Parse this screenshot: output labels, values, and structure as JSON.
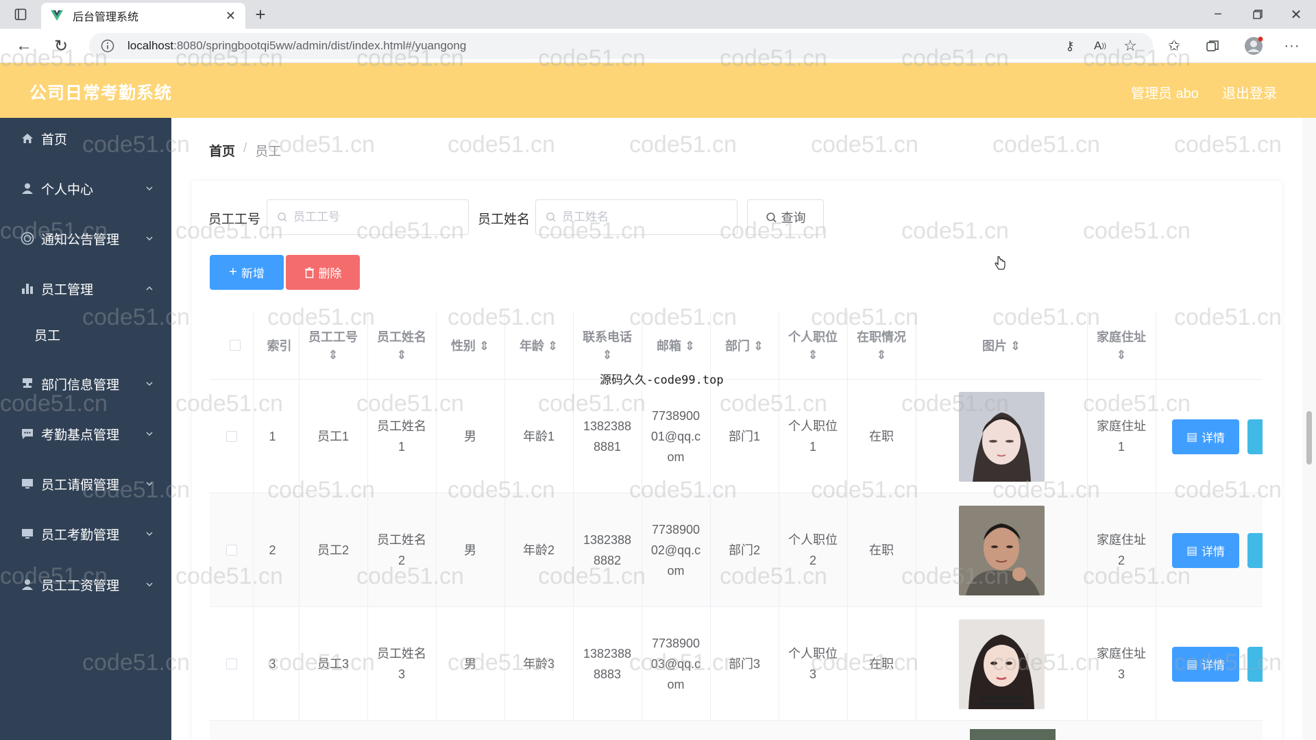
{
  "browser": {
    "tab_title": "后台管理系统",
    "url_host": "localhost",
    "url_rest": ":8080/springbootqi5ww/admin/dist/index.html#/yuangong"
  },
  "header": {
    "title": "公司日常考勤系统",
    "admin_label": "管理员 abo",
    "logout_label": "退出登录",
    "bg_color": "#fdd576"
  },
  "sidebar": {
    "bg_color": "#304156",
    "items": [
      {
        "label": "首页",
        "icon": "home-icon"
      },
      {
        "label": "个人中心",
        "icon": "user-icon"
      },
      {
        "label": "通知公告管理",
        "icon": "circle-icon"
      },
      {
        "label": "员工管理",
        "icon": "bar-chart-icon",
        "expanded": true,
        "sub": "员工"
      },
      {
        "label": "部门信息管理",
        "icon": "stamp-icon"
      },
      {
        "label": "考勤基点管理",
        "icon": "chat-icon"
      },
      {
        "label": "员工请假管理",
        "icon": "monitor-icon"
      },
      {
        "label": "员工考勤管理",
        "icon": "monitor-icon"
      },
      {
        "label": "员工工资管理",
        "icon": "user-icon"
      }
    ]
  },
  "breadcrumb": {
    "home": "首页",
    "sep": "/",
    "current": "员工"
  },
  "search": {
    "emp_no_label": "员工工号",
    "emp_no_placeholder": "员工工号",
    "emp_name_label": "员工姓名",
    "emp_name_placeholder": "员工姓名",
    "query_label": "查询"
  },
  "actions": {
    "add_label": "新增",
    "delete_label": "删除"
  },
  "table": {
    "headers": [
      "索引",
      "员工工号",
      "员工姓名",
      "性别",
      "年龄",
      "联系电话",
      "邮箱",
      "部门",
      "个人职位",
      "在职情况",
      "图片",
      "家庭住址"
    ],
    "rows": [
      {
        "index": "1",
        "emp_no": "员工1",
        "name_l1": "员工姓名",
        "name_l2": "1",
        "gender": "男",
        "age": "年龄1",
        "phone_l1": "1382388",
        "phone_l2": "8881",
        "email_l1": "7738900",
        "email_l2": "01@qq.c",
        "email_l3": "om",
        "dept": "部门1",
        "pos_l1": "个人职位",
        "pos_l2": "1",
        "status": "在职",
        "addr_l1": "家庭住址",
        "addr_l2": "1"
      },
      {
        "index": "2",
        "emp_no": "员工2",
        "name_l1": "员工姓名",
        "name_l2": "2",
        "gender": "男",
        "age": "年龄2",
        "phone_l1": "1382388",
        "phone_l2": "8882",
        "email_l1": "7738900",
        "email_l2": "02@qq.c",
        "email_l3": "om",
        "dept": "部门2",
        "pos_l1": "个人职位",
        "pos_l2": "2",
        "status": "在职",
        "addr_l1": "家庭住址",
        "addr_l2": "2"
      },
      {
        "index": "3",
        "emp_no": "员工3",
        "name_l1": "员工姓名",
        "name_l2": "3",
        "gender": "男",
        "age": "年龄3",
        "phone_l1": "1382388",
        "phone_l2": "8883",
        "email_l1": "7738900",
        "email_l2": "03@qq.c",
        "email_l3": "om",
        "dept": "部门3",
        "pos_l1": "个人职位",
        "pos_l2": "3",
        "status": "在职",
        "addr_l1": "家庭住址",
        "addr_l2": "3"
      }
    ],
    "detail_label": "详情"
  },
  "watermark": "code51.cn",
  "overlay_text": "源码久久-code99.top"
}
